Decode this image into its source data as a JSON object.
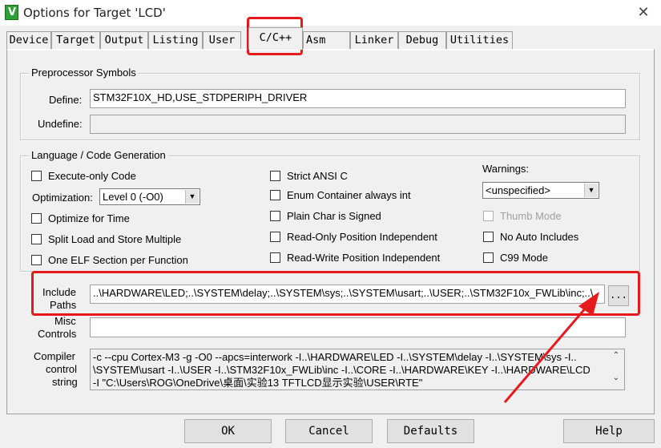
{
  "window": {
    "title": "Options for Target 'LCD'",
    "close_glyph": "✕",
    "icon_letter": "V"
  },
  "tabs": [
    "Device",
    "Target",
    "Output",
    "Listing",
    "User",
    "C/C++",
    "Asm",
    "Linker",
    "Debug",
    "Utilities"
  ],
  "preprocessor": {
    "title": "Preprocessor Symbols",
    "define_label": "Define:",
    "define_value": "STM32F10X_HD,USE_STDPERIPH_DRIVER",
    "undefine_label": "Undefine:",
    "undefine_value": ""
  },
  "language": {
    "title": "Language / Code Generation",
    "execute_only": "Execute-only Code",
    "optimization_label": "Optimization:",
    "optimization_value": "Level 0 (-O0)",
    "optimize_time": "Optimize for Time",
    "split_load": "Split Load and Store Multiple",
    "one_elf": "One ELF Section per Function",
    "strict_ansi": "Strict ANSI C",
    "enum_container": "Enum Container always int",
    "plain_char": "Plain Char is Signed",
    "ro_pi": "Read-Only Position Independent",
    "rw_pi": "Read-Write Position Independent",
    "warnings_label": "Warnings:",
    "warnings_value": "<unspecified>",
    "thumb_mode": "Thumb Mode",
    "no_auto_includes": "No Auto Includes",
    "c99_mode": "C99 Mode"
  },
  "include": {
    "label_line1": "Include",
    "label_line2": "Paths",
    "value": "..\\HARDWARE\\LED;..\\SYSTEM\\delay;..\\SYSTEM\\sys;..\\SYSTEM\\usart;..\\USER;..\\STM32F10x_FWLib\\inc;..\\",
    "browse_label": "..."
  },
  "misc": {
    "label_line1": "Misc",
    "label_line2": "Controls",
    "value": ""
  },
  "compiler": {
    "label_line1": "Compiler",
    "label_line2": "control",
    "label_line3": "string",
    "line1": "-c --cpu Cortex-M3 -g -O0 --apcs=interwork -I..\\HARDWARE\\LED -I..\\SYSTEM\\delay -I..\\SYSTEM\\sys -I..",
    "line2": "\\SYSTEM\\usart -I..\\USER -I..\\STM32F10x_FWLib\\inc -I..\\CORE -I..\\HARDWARE\\KEY -I..\\HARDWARE\\LCD",
    "line3": "-I \"C:\\Users\\ROG\\OneDrive\\桌面\\实验13 TFTLCD显示实验\\USER\\RTE\""
  },
  "buttons": {
    "ok": "OK",
    "cancel": "Cancel",
    "defaults": "Defaults",
    "help": "Help"
  },
  "annotation_color": "#e6191c"
}
